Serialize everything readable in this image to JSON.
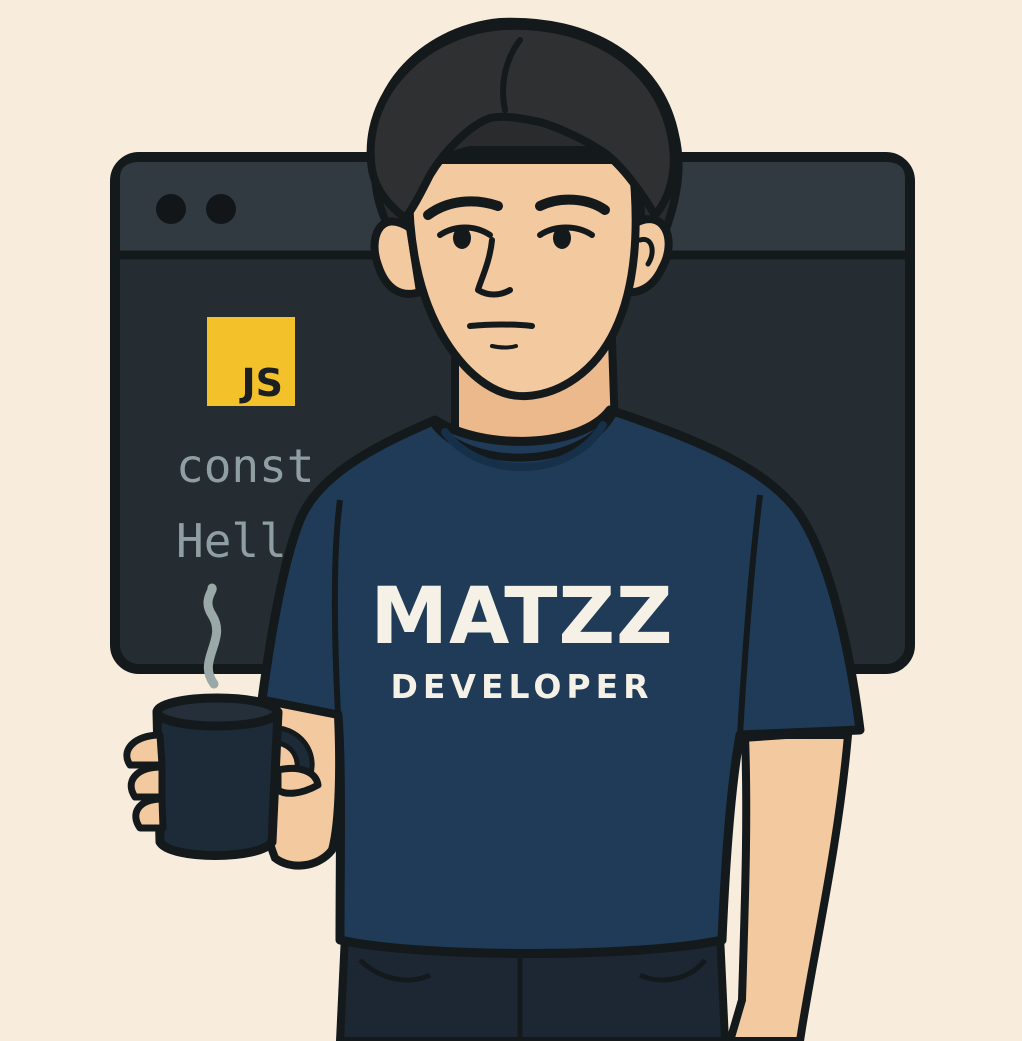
{
  "code_window": {
    "badge_label": "JS",
    "code_line_1": "const",
    "code_line_2": "Hello"
  },
  "shirt": {
    "title": "MATZZ",
    "subtitle": "DEVELOPER"
  },
  "colors": {
    "background": "#f8ecdd",
    "window": "#262d32",
    "js_yellow": "#f3c22b",
    "shirt": "#1f3b58",
    "skin": "#f3c9a0",
    "hair": "#2a2b2c",
    "outline": "#14191c"
  }
}
